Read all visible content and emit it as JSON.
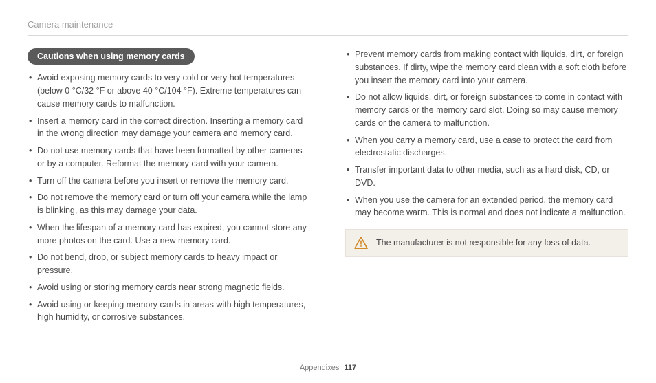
{
  "header": {
    "title": "Camera maintenance"
  },
  "section": {
    "heading": "Cautions when using memory cards"
  },
  "left_bullets": [
    "Avoid exposing memory cards to very cold or very hot temperatures (below 0 °C/32 °F or above 40 °C/104 °F). Extreme temperatures can cause memory cards to malfunction.",
    "Insert a memory card in the correct direction. Inserting a memory card in the wrong direction may damage your camera and memory card.",
    "Do not use memory cards that have been formatted by other cameras or by a computer. Reformat the memory card with your camera.",
    "Turn off the camera before you insert or remove the memory card.",
    "Do not remove the memory card or turn off your camera while the lamp is blinking, as this may damage your data.",
    "When the lifespan of a memory card has expired, you cannot store any more photos on the card. Use a new memory card.",
    "Do not bend, drop, or subject memory cards to heavy impact or pressure.",
    "Avoid using or storing memory cards near strong magnetic fields.",
    "Avoid using or keeping memory cards in areas with high temperatures, high humidity, or corrosive substances."
  ],
  "right_bullets": [
    "Prevent memory cards from making contact with liquids, dirt, or foreign substances. If dirty, wipe the memory card clean with a soft cloth before you insert the memory card into your camera.",
    "Do not allow liquids, dirt, or foreign substances to come in contact with memory cards or the memory card slot. Doing so may cause memory cards or the camera to malfunction.",
    "When you carry a memory card, use a case to protect the card from electrostatic discharges.",
    "Transfer important data to other media, such as a hard disk, CD, or DVD.",
    "When you use the camera for an extended period, the memory card may become warm. This is normal and does not indicate a malfunction."
  ],
  "note": {
    "icon": "caution-icon",
    "text": "The manufacturer is not responsible for any loss of data."
  },
  "footer": {
    "section": "Appendixes",
    "page": "117"
  }
}
